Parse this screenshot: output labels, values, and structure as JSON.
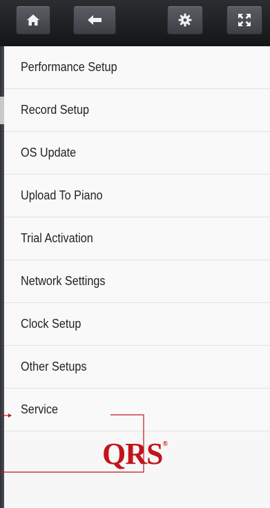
{
  "toolbar": {
    "buttons": [
      {
        "icon": "home-icon"
      },
      {
        "icon": "back-arrow-icon"
      },
      {
        "icon": "gear-icon"
      },
      {
        "icon": "fullscreen-icon"
      }
    ]
  },
  "menu": {
    "items": [
      {
        "label": "Performance Setup"
      },
      {
        "label": "Record Setup"
      },
      {
        "label": "OS Update"
      },
      {
        "label": "Upload To Piano"
      },
      {
        "label": "Trial Activation"
      },
      {
        "label": "Network Settings"
      },
      {
        "label": "Clock Setup"
      },
      {
        "label": "Other Setups"
      },
      {
        "label": "Service"
      }
    ]
  },
  "logo": {
    "text": "QRS",
    "mark": "®"
  },
  "colors": {
    "accent": "#c3141b",
    "toolbar": "#1e2023",
    "panel": "#f7f7f7"
  }
}
